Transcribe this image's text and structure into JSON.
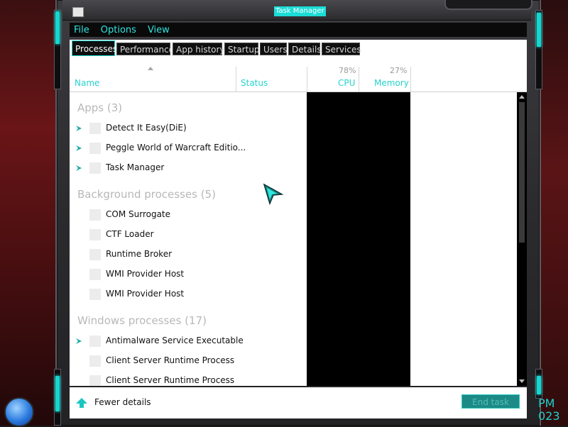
{
  "window": {
    "title": "Task Manager"
  },
  "menu": [
    "File",
    "Options",
    "View"
  ],
  "tabs": [
    "Processes",
    "Performance",
    "App history",
    "Startup",
    "Users",
    "Details",
    "Services"
  ],
  "columns": {
    "name": "Name",
    "status": "Status",
    "cpu": {
      "label": "CPU",
      "percent": "78%"
    },
    "memory": {
      "label": "Memory",
      "percent": "27%"
    }
  },
  "groups": {
    "apps": {
      "title": "Apps (3)",
      "items": [
        "Detect It Easy(DiE)",
        "Peggle World of Warcraft Editio...",
        "Task Manager"
      ]
    },
    "background": {
      "title": "Background processes (5)",
      "items": [
        "COM Surrogate",
        "CTF Loader",
        "Runtime Broker",
        "WMI Provider Host",
        "WMI Provider Host"
      ]
    },
    "windows": {
      "title": "Windows processes (17)",
      "items": [
        "Antimalware Service Executable",
        "Client Server Runtime Process",
        "Client Server Runtime Process"
      ]
    }
  },
  "footer": {
    "fewer_details": "Fewer details",
    "end_task": "End task"
  },
  "clock": {
    "line1": "PM",
    "line2": "023"
  },
  "colors": {
    "accent": "#1bd8d2",
    "frame": "#2b2b2e"
  }
}
